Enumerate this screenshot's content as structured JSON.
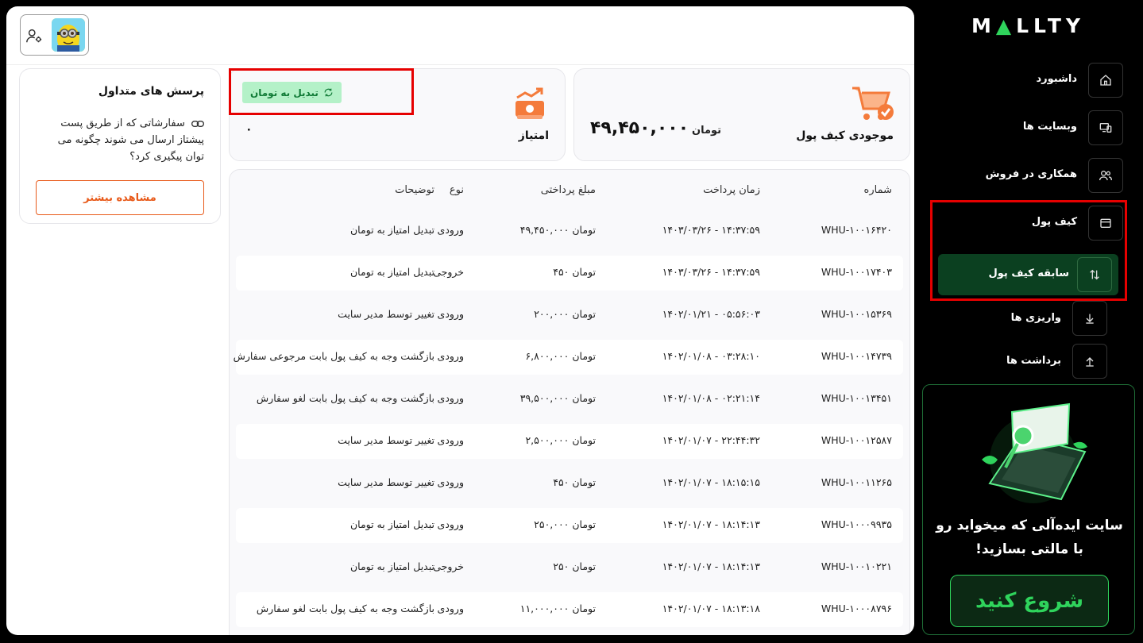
{
  "brand": {
    "logo_text_1": "M",
    "logo_text_2": "LLTY",
    "accent": "#2fd45c"
  },
  "faq": {
    "title": "پرسش های متداول",
    "question": "سفارشاتی که از طریق پست پیشتاز ارسال می شوند چگونه می توان پیگیری کرد؟",
    "button": "مشاهده بیشتر"
  },
  "points": {
    "label": "امتیاز",
    "value": "۰",
    "convert_button": "تبدیل به تومان"
  },
  "wallet": {
    "label": "موجودی کیف پول",
    "unit": "تومان",
    "value": "۴۹,۴۵۰,۰۰۰"
  },
  "table": {
    "headers": {
      "id": "شماره",
      "time": "زمان پرداخت",
      "amount": "مبلغ پرداختی",
      "type": "نوع",
      "desc": "توضیحات"
    },
    "rows": [
      {
        "id": "WHU-۱۰۰۱۶۴۲۰",
        "time": "۱۴۰۳/۰۳/۲۶ - ۱۴:۳۷:۵۹",
        "amount": "۴۹,۴۵۰,۰۰۰ تومان",
        "type": "ورودی",
        "desc": "تبدیل امتیاز به تومان"
      },
      {
        "id": "WHU-۱۰۰۱۷۴۰۳",
        "time": "۱۴۰۳/۰۳/۲۶ - ۱۴:۳۷:۵۹",
        "amount": "۴۵۰ تومان",
        "type": "خروجی",
        "desc": "تبدیل امتیاز به تومان"
      },
      {
        "id": "WHU-۱۰۰۱۵۳۶۹",
        "time": "۱۴۰۲/۰۱/۲۱ - ۰۵:۵۶:۰۳",
        "amount": "۲۰۰,۰۰۰ تومان",
        "type": "ورودی",
        "desc": "تغییر توسط مدیر سایت"
      },
      {
        "id": "WHU-۱۰۰۱۴۷۳۹",
        "time": "۱۴۰۲/۰۱/۰۸ - ۰۳:۲۸:۱۰",
        "amount": "۶,۸۰۰,۰۰۰ تومان",
        "type": "ورودی",
        "desc": "بازگشت وجه به کیف پول بابت مرجوعی سفارش"
      },
      {
        "id": "WHU-۱۰۰۱۳۴۵۱",
        "time": "۱۴۰۲/۰۱/۰۸ - ۰۲:۲۱:۱۴",
        "amount": "۳۹,۵۰۰,۰۰۰ تومان",
        "type": "ورودی",
        "desc": "بازگشت وجه به کیف پول بابت لغو سفارش"
      },
      {
        "id": "WHU-۱۰۰۱۲۵۸۷",
        "time": "۱۴۰۲/۰۱/۰۷ - ۲۲:۴۴:۳۲",
        "amount": "۲,۵۰۰,۰۰۰ تومان",
        "type": "ورودی",
        "desc": "تغییر توسط مدیر سایت"
      },
      {
        "id": "WHU-۱۰۰۱۱۲۶۵",
        "time": "۱۴۰۲/۰۱/۰۷ - ۱۸:۱۵:۱۵",
        "amount": "۴۵۰ تومان",
        "type": "ورودی",
        "desc": "تغییر توسط مدیر سایت"
      },
      {
        "id": "WHU-۱۰۰۰۹۹۳۵",
        "time": "۱۴۰۲/۰۱/۰۷ - ۱۸:۱۴:۱۳",
        "amount": "۲۵۰,۰۰۰ تومان",
        "type": "ورودی",
        "desc": "تبدیل امتیاز به تومان"
      },
      {
        "id": "WHU-۱۰۰۱۰۲۲۱",
        "time": "۱۴۰۲/۰۱/۰۷ - ۱۸:۱۴:۱۳",
        "amount": "۲۵۰ تومان",
        "type": "خروجی",
        "desc": "تبدیل امتیاز به تومان"
      },
      {
        "id": "WHU-۱۰۰۰۸۷۹۶",
        "time": "۱۴۰۲/۰۱/۰۷ - ۱۸:۱۳:۱۸",
        "amount": "۱۱,۰۰۰,۰۰۰ تومان",
        "type": "ورودی",
        "desc": "بازگشت وجه به کیف پول بابت لغو سفارش"
      }
    ]
  },
  "nav": {
    "dashboard": "داشبورد",
    "websites": "وبسایت ها",
    "affiliate": "همکاری در فروش",
    "wallet": "کیف پول",
    "wallet_history": "سابقه کیف پول",
    "deposits": "واریزی ها",
    "withdrawals": "برداشت ها"
  },
  "promo": {
    "text": "سایت ایده‌آلی که میخواید رو با مالتی بسازید!",
    "button": "شروع کنید"
  }
}
